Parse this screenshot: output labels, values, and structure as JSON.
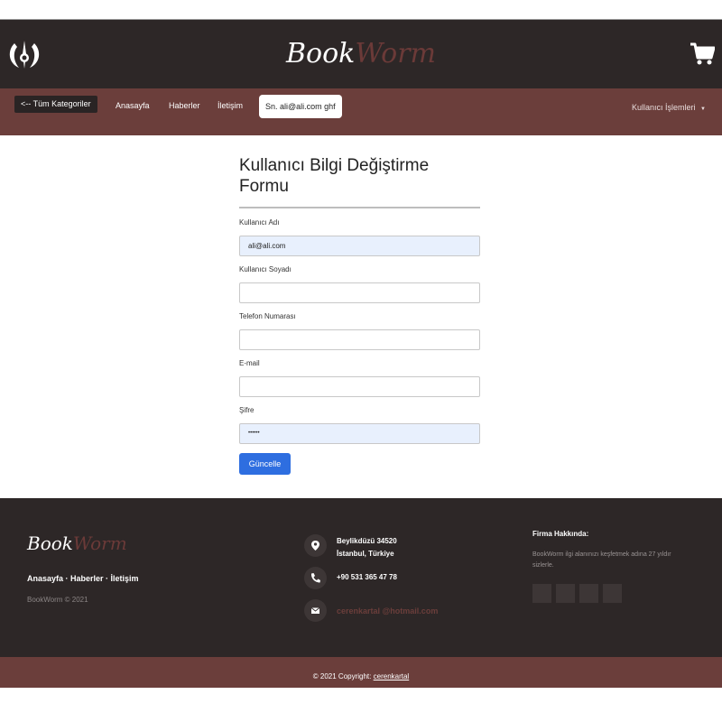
{
  "header": {
    "brand_part1": "Book",
    "brand_part2": "Worm",
    "emblem_icon": "jedi-order-icon",
    "cart_icon": "shopping-cart-icon"
  },
  "nav": {
    "categories_label": "<-- Tüm Kategoriler",
    "links": [
      "Anasayfa",
      "Haberler",
      "İletişim"
    ],
    "user_label": "Sn. ali@ali.com ghf",
    "user_menu_label": "Kullanıcı İşlemleri"
  },
  "form": {
    "title": "Kullanıcı Bilgi Değiştirme Formu",
    "fields": [
      {
        "label": "Kullanıcı Adı",
        "value": "ali@ali.com"
      },
      {
        "label": "Kullanıcı Soyadı",
        "value": ""
      },
      {
        "label": "Telefon Numarası",
        "value": ""
      },
      {
        "label": "E-mail",
        "value": ""
      },
      {
        "label": "Şifre",
        "value": "••••••"
      }
    ],
    "submit_label": "Güncelle"
  },
  "footer": {
    "brand_part1": "Book",
    "brand_part2": "Worm",
    "links": "Anasayfa · Haberler · İletişim",
    "copyright": "BookWorm © 2021",
    "address_line1": "Beylikdüzü 34520",
    "address_line2": "İstanbul, Türkiye",
    "phone": "+90 531 365 47 78",
    "email": "cerenkartal @hotmail.com",
    "about_heading": "Firma Hakkında:",
    "about_text": "BookWorm ilgi alanınızı keşfetmek adına 27 yıldır sizlerle."
  },
  "bottom": {
    "copyright_prefix": "© 2021 Copyright:",
    "owner": "cerenkartal"
  },
  "colors": {
    "header_bg": "#2d2727",
    "nav_bg": "#6b3e3b",
    "button_blue": "#2e6ee0",
    "autofill_bg": "#e8f0fd"
  }
}
